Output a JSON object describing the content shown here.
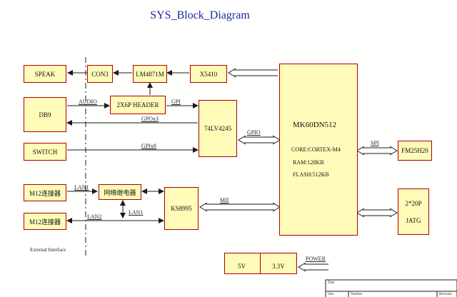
{
  "title": "SYS_Block_Diagram",
  "blocks": {
    "speak": "SPEAK",
    "con3": "CON3",
    "lm4871m": "LM4871M",
    "x5410": "X5410",
    "db9": "DB9",
    "header": "2X6P HEADER",
    "lv4245": "74LV4245",
    "switch": "SWITCH",
    "m12_1": "M12连接器",
    "m12_2": "M12连接器",
    "relay": "网络继电器",
    "ks8995": "KS8995",
    "mcu_name": "MK60DN512",
    "mcu_core": "CORE:CORTEX-M4",
    "mcu_ram": "RAM:128KB",
    "mcu_flash": "FLASH:512KB",
    "fm25h20": "FM25H20",
    "jatg_top": "2*20P",
    "jatg_bottom": "JATG",
    "v5": "5V",
    "v33": "3.3V"
  },
  "signals": {
    "audio": "AUDIO",
    "gpi": "GPI",
    "gpox3": "GPOx3",
    "gpio": "GPIO",
    "gpix8": "GPIx8",
    "spi": "SPI",
    "lan1_a": "LAN1",
    "lan1_b": "LAN1",
    "lan2": "LAN2",
    "mii": "MII",
    "power": "POWER"
  },
  "external_label": "External Interface",
  "title_block": {
    "title": "Title",
    "size": "Size",
    "number": "Number",
    "revision": "Revision"
  }
}
